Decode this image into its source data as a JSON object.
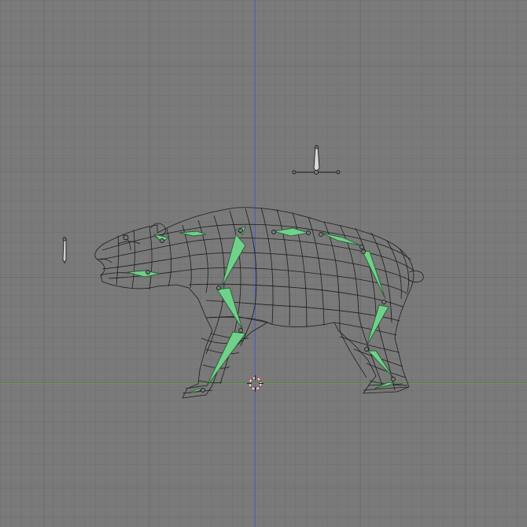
{
  "viewport": {
    "view": "side-orthographic",
    "background": "#7a7a7a",
    "grid_minor_color": "#6d6d6d",
    "grid_major_color": "#5f5f5f",
    "z_axis_color": "#4a5bb3",
    "y_axis_color": "#5f9a4a",
    "mesh_wire_color": "#1e1e1e",
    "bone_fill": "#6fd18a",
    "bone_stroke": "#2a5a34"
  },
  "objects": {
    "mesh": "bear-wireframe-mesh",
    "armature": "bear-armature",
    "camera": "camera-object",
    "lamp": "lamp-object",
    "cursor": "3d-cursor"
  }
}
